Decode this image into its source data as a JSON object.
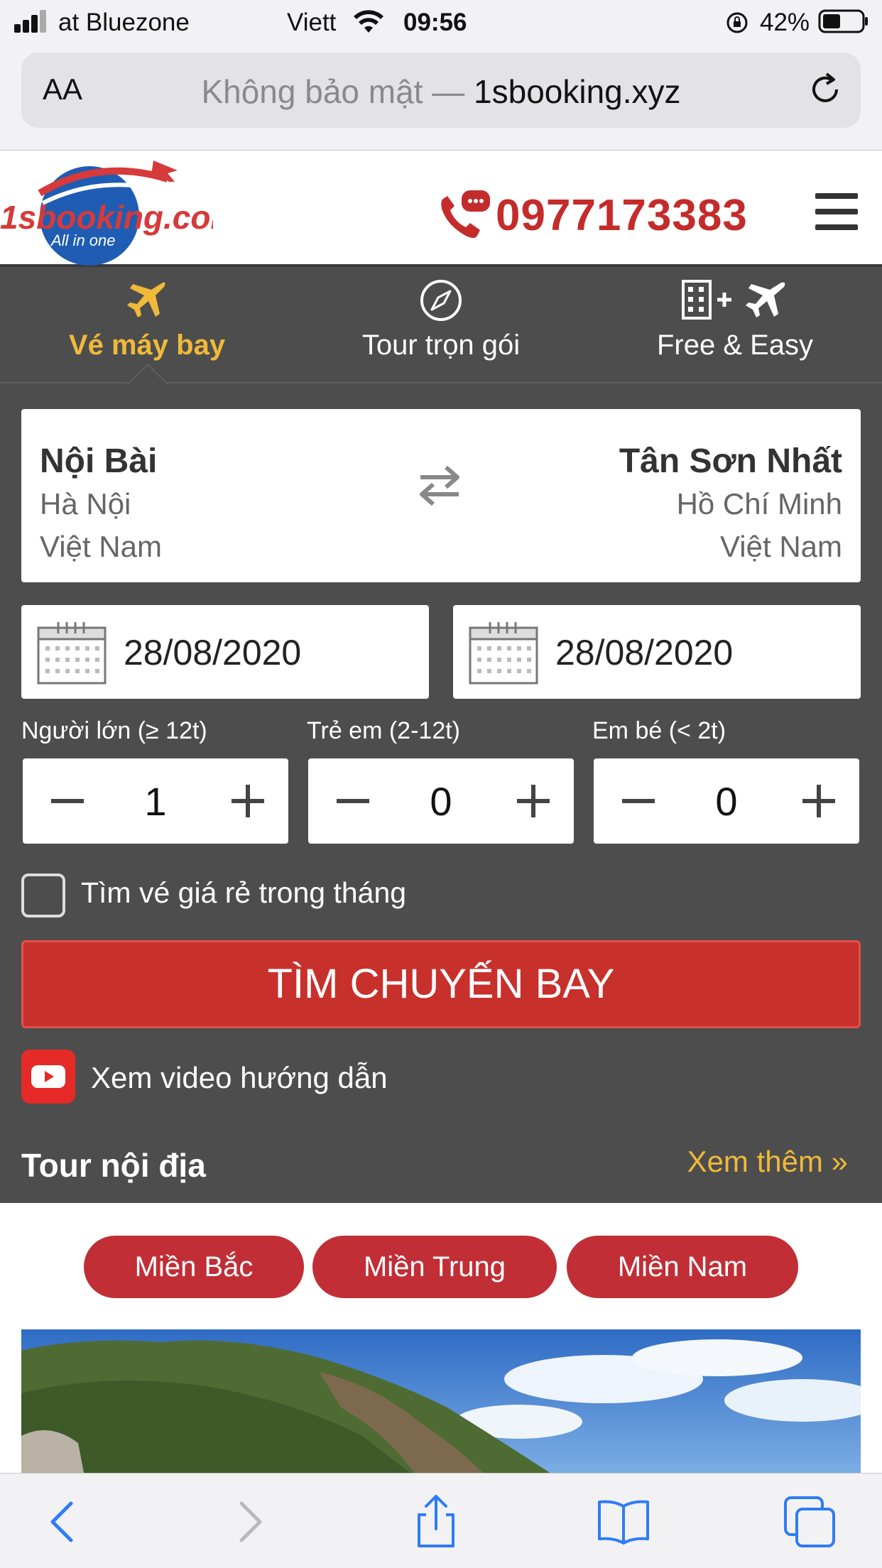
{
  "status_bar": {
    "carrier": "at Bluezone",
    "carrier2": "Viett",
    "time": "09:56",
    "battery": "42%"
  },
  "address_bar": {
    "text_size_label": "AA",
    "security_text": "Không bảo mật —",
    "domain": "1sbooking.xyz"
  },
  "header": {
    "logo_text": "1sbooking.com",
    "logo_tagline": "All in one",
    "phone": "0977173383"
  },
  "tabs": [
    {
      "label": "Vé máy bay",
      "active": true,
      "icon": "airplane-icon"
    },
    {
      "label": "Tour trọn gói",
      "active": false,
      "icon": "compass-icon"
    },
    {
      "label": "Free & Easy",
      "active": false,
      "icon": "hotel-plus-flight-icon"
    }
  ],
  "route": {
    "from": {
      "code": "Nội Bài",
      "city": "Hà Nội",
      "country": "Việt Nam"
    },
    "to": {
      "code": "Tân Sơn Nhất",
      "city": "Hồ Chí Minh",
      "country": "Việt Nam"
    }
  },
  "dates": {
    "depart": "28/08/2020",
    "return": "28/08/2020"
  },
  "passengers": [
    {
      "label": "Người lớn (≥ 12t)",
      "value": "1"
    },
    {
      "label": "Trẻ em (2-12t)",
      "value": "0"
    },
    {
      "label": "Em bé (< 2t)",
      "value": "0"
    }
  ],
  "cheap_fare_checkbox": {
    "label": "Tìm vé giá rẻ trong tháng",
    "checked": false
  },
  "search_button": "TÌM CHUYẾN BAY",
  "video_link": "Xem video hướng dẫn",
  "tour_section": {
    "title": "Tour nội địa",
    "more": "Xem thêm »",
    "regions": [
      "Miền Bắc",
      "Miền Trung",
      "Miền Nam"
    ]
  },
  "colors": {
    "accent_red": "#c42b2b",
    "tab_active": "#f0b93a",
    "panel_bg": "#4d4d4d",
    "region_pill": "#c12e36"
  }
}
